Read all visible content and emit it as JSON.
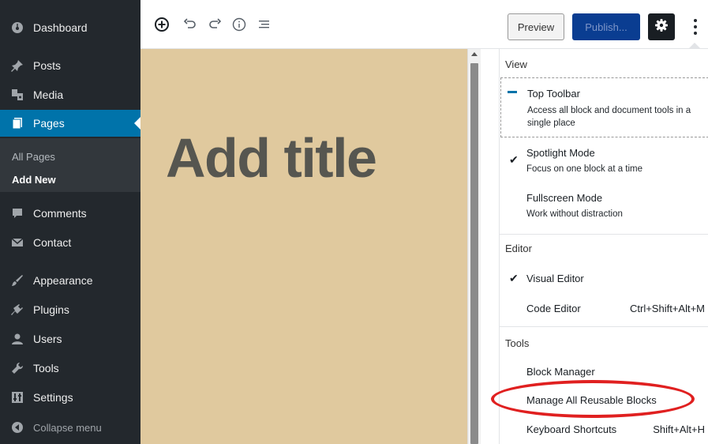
{
  "sidebar": {
    "items": [
      {
        "label": "Dashboard",
        "icon": "dashboard-icon"
      },
      {
        "label": "Posts",
        "icon": "pin-icon"
      },
      {
        "label": "Media",
        "icon": "media-icon"
      },
      {
        "label": "Pages",
        "icon": "page-icon",
        "active": true
      },
      {
        "label": "Comments",
        "icon": "comment-icon"
      },
      {
        "label": "Contact",
        "icon": "mail-icon"
      },
      {
        "label": "Appearance",
        "icon": "brush-icon"
      },
      {
        "label": "Plugins",
        "icon": "plug-icon"
      },
      {
        "label": "Users",
        "icon": "users-icon"
      },
      {
        "label": "Tools",
        "icon": "wrench-icon"
      },
      {
        "label": "Settings",
        "icon": "settings-icon"
      }
    ],
    "submenu": [
      {
        "label": "All Pages"
      },
      {
        "label": "Add New",
        "current": true
      }
    ],
    "collapse_label": "Collapse menu"
  },
  "toolbar": {
    "preview_label": "Preview",
    "publish_label": "Publish...",
    "icons": [
      "add-block-icon",
      "undo-icon",
      "redo-icon",
      "info-icon",
      "list-view-icon"
    ]
  },
  "editor": {
    "title_placeholder": "Add title"
  },
  "menu": {
    "view": {
      "title": "View",
      "items": [
        {
          "label": "Top Toolbar",
          "desc": "Access all block and document tools in a single place",
          "checked": false
        },
        {
          "label": "Spotlight Mode",
          "desc": "Focus on one block at a time",
          "checked": true
        },
        {
          "label": "Fullscreen Mode",
          "desc": "Work without distraction",
          "checked": false
        }
      ]
    },
    "editor": {
      "title": "Editor",
      "items": [
        {
          "label": "Visual Editor",
          "checked": true,
          "shortcut": ""
        },
        {
          "label": "Code Editor",
          "checked": false,
          "shortcut": "Ctrl+Shift+Alt+M"
        }
      ]
    },
    "tools": {
      "title": "Tools",
      "items": [
        {
          "label": "Block Manager",
          "shortcut": ""
        },
        {
          "label": "Manage All Reusable Blocks",
          "shortcut": "",
          "highlighted": true
        },
        {
          "label": "Keyboard Shortcuts",
          "shortcut": "Shift+Alt+H"
        }
      ]
    }
  },
  "colors": {
    "sidebar_bg": "#23282d",
    "active_blue": "#0073aa",
    "canvas_bg": "#e0c99e",
    "publish_bg": "#0a3d91",
    "highlight_red": "#e02020"
  }
}
